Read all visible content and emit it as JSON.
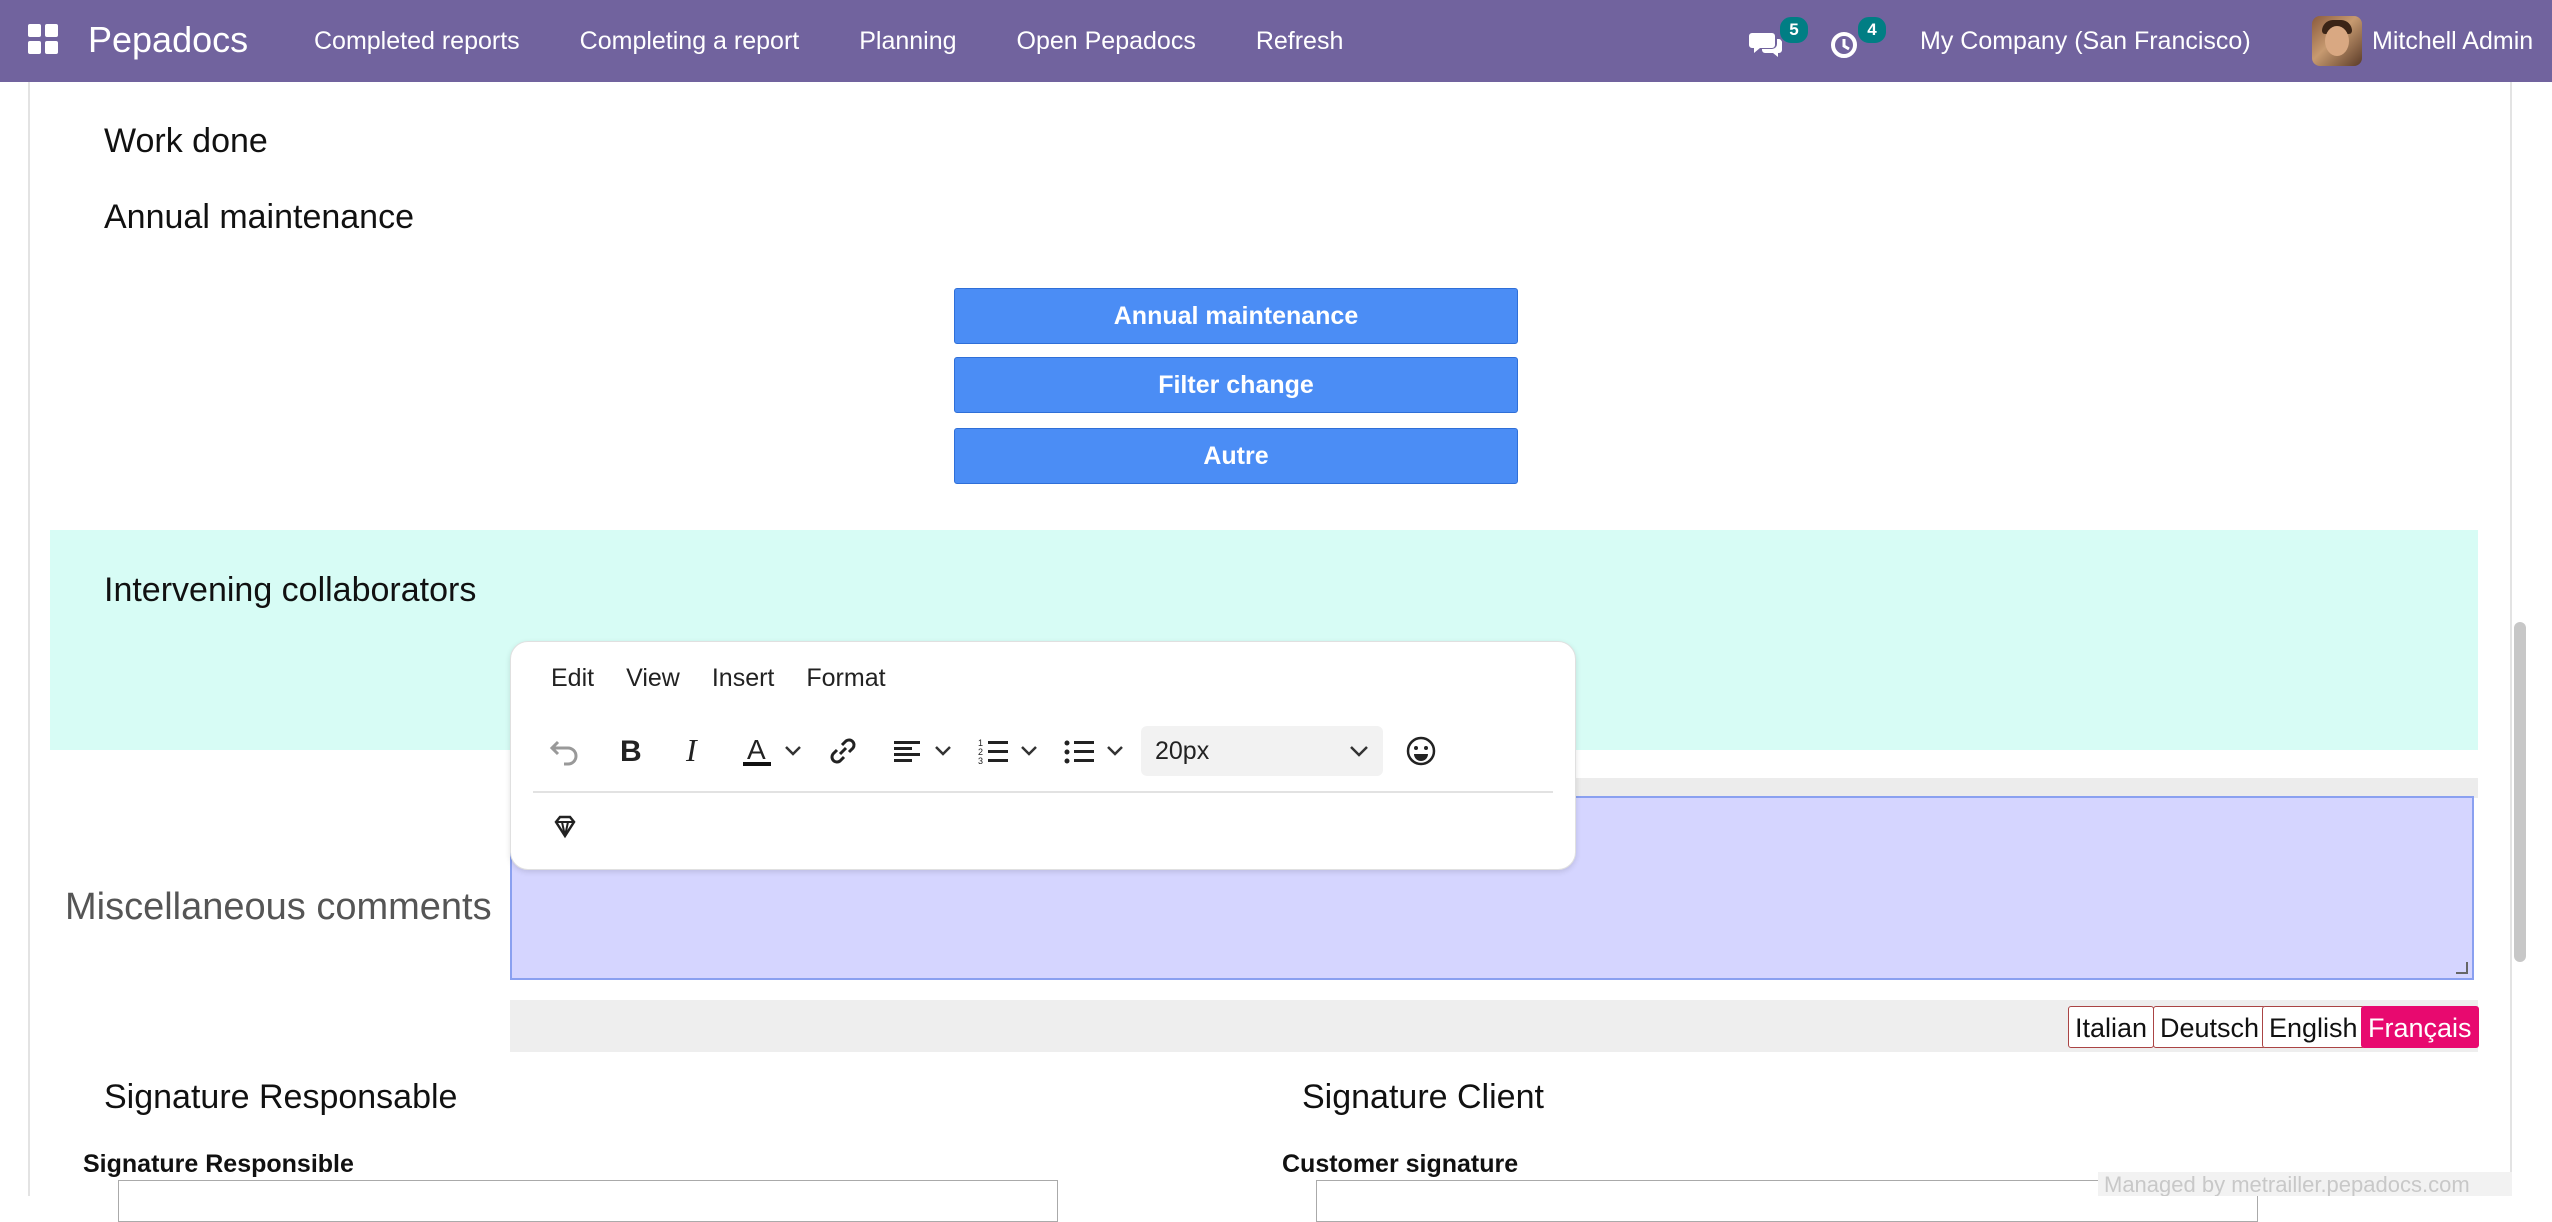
{
  "topbar": {
    "brand": "Pepadocs",
    "menu": [
      "Completed reports",
      "Completing a report",
      "Planning",
      "Open Pepadocs",
      "Refresh"
    ],
    "messages_count": "5",
    "activities_count": "4",
    "company": "My Company (San Francisco)",
    "user": "Mitchell Admin"
  },
  "sections": {
    "work_done": "Work done",
    "annual_maintenance": "Annual maintenance",
    "intervening_collaborators": "Intervening collaborators",
    "misc_comments": "Miscellaneous comments",
    "signature_responsable": "Signature Responsable",
    "signature_client": "Signature Client",
    "signature_responsible_label": "Signature Responsible",
    "customer_signature_label": "Customer signature"
  },
  "buttons": [
    "Annual maintenance",
    "Filter change",
    "Autre"
  ],
  "editor": {
    "menu": [
      "Edit",
      "View",
      "Insert",
      "Format"
    ],
    "font_size": "20px"
  },
  "languages": {
    "items": [
      "Italian",
      "Deutsch",
      "English",
      "Français"
    ],
    "active": "Français"
  },
  "footer": {
    "managed": "Managed by metrailler.pepadocs.com"
  },
  "colors": {
    "topbar": "#71639e",
    "button_blue": "#4b8df5",
    "collab_band": "#d7fcf5",
    "comment_area": "#d5d5ff",
    "lang_active": "#e8096f",
    "badge": "#017e84"
  }
}
